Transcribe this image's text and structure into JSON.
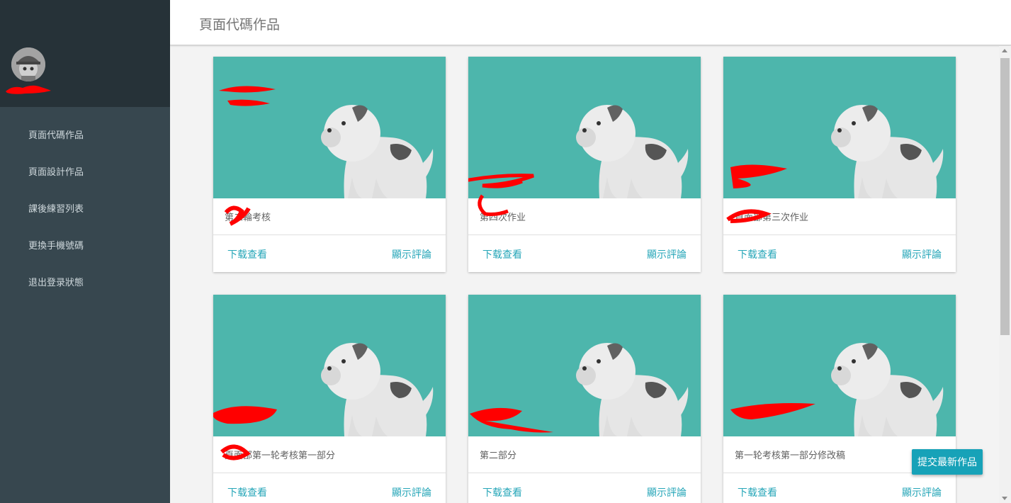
{
  "header": {
    "title": "頁面代碼作品"
  },
  "sidebar": {
    "avatar_icon": "avatar-icon",
    "items": [
      {
        "label": "頁面代碼作品"
      },
      {
        "label": "頁面設計作品"
      },
      {
        "label": "課後練習列表"
      },
      {
        "label": "更換手機號碼"
      },
      {
        "label": "退出登录狀態"
      }
    ]
  },
  "cards": [
    {
      "title": "第二輪考核",
      "download_label": "下载查看",
      "comments_label": "顯示評論"
    },
    {
      "title": "第四次作业",
      "download_label": "下载查看",
      "comments_label": "顯示評論"
    },
    {
      "title": "頁面部第三次作业",
      "download_label": "下载查看",
      "comments_label": "顯示評論"
    },
    {
      "title": "頁面部第一轮考核第一部分",
      "download_label": "下载查看",
      "comments_label": "顯示評論"
    },
    {
      "title": "第二部分",
      "download_label": "下载查看",
      "comments_label": "顯示評論"
    },
    {
      "title": "第一轮考核第一部分修改稿",
      "download_label": "下载查看",
      "comments_label": "顯示評論"
    }
  ],
  "fab": {
    "label": "提交最新作品"
  },
  "colors": {
    "sidebar": "#37474f",
    "sidebar_head": "#263238",
    "card_image": "#4db6ac",
    "accent": "#26a6b8",
    "fab": "#17a2b8",
    "redaction": "#ff0000"
  }
}
